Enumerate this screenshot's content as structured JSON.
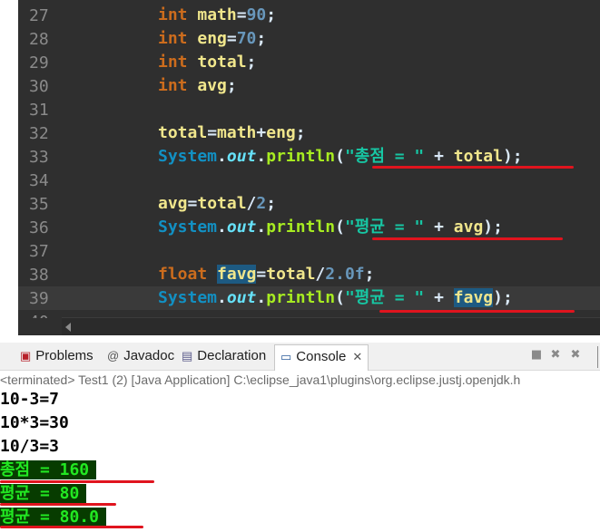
{
  "editor": {
    "lines": [
      {
        "num": "27",
        "tokens": [
          {
            "t": "int ",
            "c": "kw"
          },
          {
            "t": "math",
            "c": "var"
          },
          {
            "t": "=",
            "c": ""
          },
          {
            "t": "90",
            "c": "num"
          },
          {
            "t": ";",
            "c": ""
          }
        ]
      },
      {
        "num": "28",
        "tokens": [
          {
            "t": "int ",
            "c": "kw"
          },
          {
            "t": "eng",
            "c": "var"
          },
          {
            "t": "=",
            "c": ""
          },
          {
            "t": "70",
            "c": "num"
          },
          {
            "t": ";",
            "c": ""
          }
        ]
      },
      {
        "num": "29",
        "tokens": [
          {
            "t": "int ",
            "c": "kw"
          },
          {
            "t": "total",
            "c": "var"
          },
          {
            "t": ";",
            "c": ""
          }
        ]
      },
      {
        "num": "30",
        "tokens": [
          {
            "t": "int ",
            "c": "kw"
          },
          {
            "t": "avg",
            "c": "var"
          },
          {
            "t": ";",
            "c": ""
          }
        ]
      },
      {
        "num": "31",
        "tokens": []
      },
      {
        "num": "32",
        "tokens": [
          {
            "t": "total",
            "c": "var"
          },
          {
            "t": "=",
            "c": ""
          },
          {
            "t": "math",
            "c": "var"
          },
          {
            "t": "+",
            "c": ""
          },
          {
            "t": "eng",
            "c": "var"
          },
          {
            "t": ";",
            "c": ""
          }
        ]
      },
      {
        "num": "33",
        "tokens": [
          {
            "t": "System",
            "c": "cls"
          },
          {
            "t": ".",
            "c": ""
          },
          {
            "t": "out",
            "c": "fld"
          },
          {
            "t": ".",
            "c": ""
          },
          {
            "t": "println",
            "c": "mth"
          },
          {
            "t": "(",
            "c": ""
          },
          {
            "t": "\"총점 = \"",
            "c": "str"
          },
          {
            "t": " + ",
            "c": ""
          },
          {
            "t": "total",
            "c": "var"
          },
          {
            "t": ");",
            "c": ""
          }
        ]
      },
      {
        "num": "34",
        "tokens": []
      },
      {
        "num": "35",
        "tokens": [
          {
            "t": "avg",
            "c": "var"
          },
          {
            "t": "=",
            "c": ""
          },
          {
            "t": "total",
            "c": "var"
          },
          {
            "t": "/",
            "c": ""
          },
          {
            "t": "2",
            "c": "num"
          },
          {
            "t": ";",
            "c": ""
          }
        ]
      },
      {
        "num": "36",
        "tokens": [
          {
            "t": "System",
            "c": "cls"
          },
          {
            "t": ".",
            "c": ""
          },
          {
            "t": "out",
            "c": "fld"
          },
          {
            "t": ".",
            "c": ""
          },
          {
            "t": "println",
            "c": "mth"
          },
          {
            "t": "(",
            "c": ""
          },
          {
            "t": "\"평균 = \"",
            "c": "str"
          },
          {
            "t": " + ",
            "c": ""
          },
          {
            "t": "avg",
            "c": "var"
          },
          {
            "t": ");",
            "c": ""
          }
        ]
      },
      {
        "num": "37",
        "tokens": []
      },
      {
        "num": "38",
        "tokens": [
          {
            "t": "float ",
            "c": "kw"
          },
          {
            "t": "favg",
            "c": "var hl"
          },
          {
            "t": "=",
            "c": ""
          },
          {
            "t": "total",
            "c": "var"
          },
          {
            "t": "/",
            "c": ""
          },
          {
            "t": "2.0f",
            "c": "num"
          },
          {
            "t": ";",
            "c": ""
          }
        ]
      },
      {
        "num": "39",
        "tokens": [
          {
            "t": "System",
            "c": "cls"
          },
          {
            "t": ".",
            "c": ""
          },
          {
            "t": "out",
            "c": "fld"
          },
          {
            "t": ".",
            "c": ""
          },
          {
            "t": "println",
            "c": "mth"
          },
          {
            "t": "(",
            "c": ""
          },
          {
            "t": "\"평균 = \"",
            "c": "str"
          },
          {
            "t": " + ",
            "c": ""
          },
          {
            "t": "favg",
            "c": "var hl"
          },
          {
            "t": ");",
            "c": ""
          }
        ],
        "current": true
      }
    ],
    "partial_line_number": "40"
  },
  "tabs": {
    "problems": "Problems",
    "javadoc": "Javadoc",
    "declaration": "Declaration",
    "console": "Console"
  },
  "console": {
    "status": "<terminated> Test1 (2) [Java Application] C:\\eclipse_java1\\plugins\\org.eclipse.justj.openjdk.h",
    "output": [
      "10-3=7",
      "10*3=30",
      "10/3=3",
      "총점 = 160",
      "평균 = 80",
      "평균 = 80.0"
    ],
    "highlighted_from": 3
  },
  "colors": {
    "editor_bg": "#2f2f2f",
    "annotation_red": "#e0141e",
    "console_highlight_bg": "#073c00",
    "console_highlight_fg": "#22e822"
  }
}
